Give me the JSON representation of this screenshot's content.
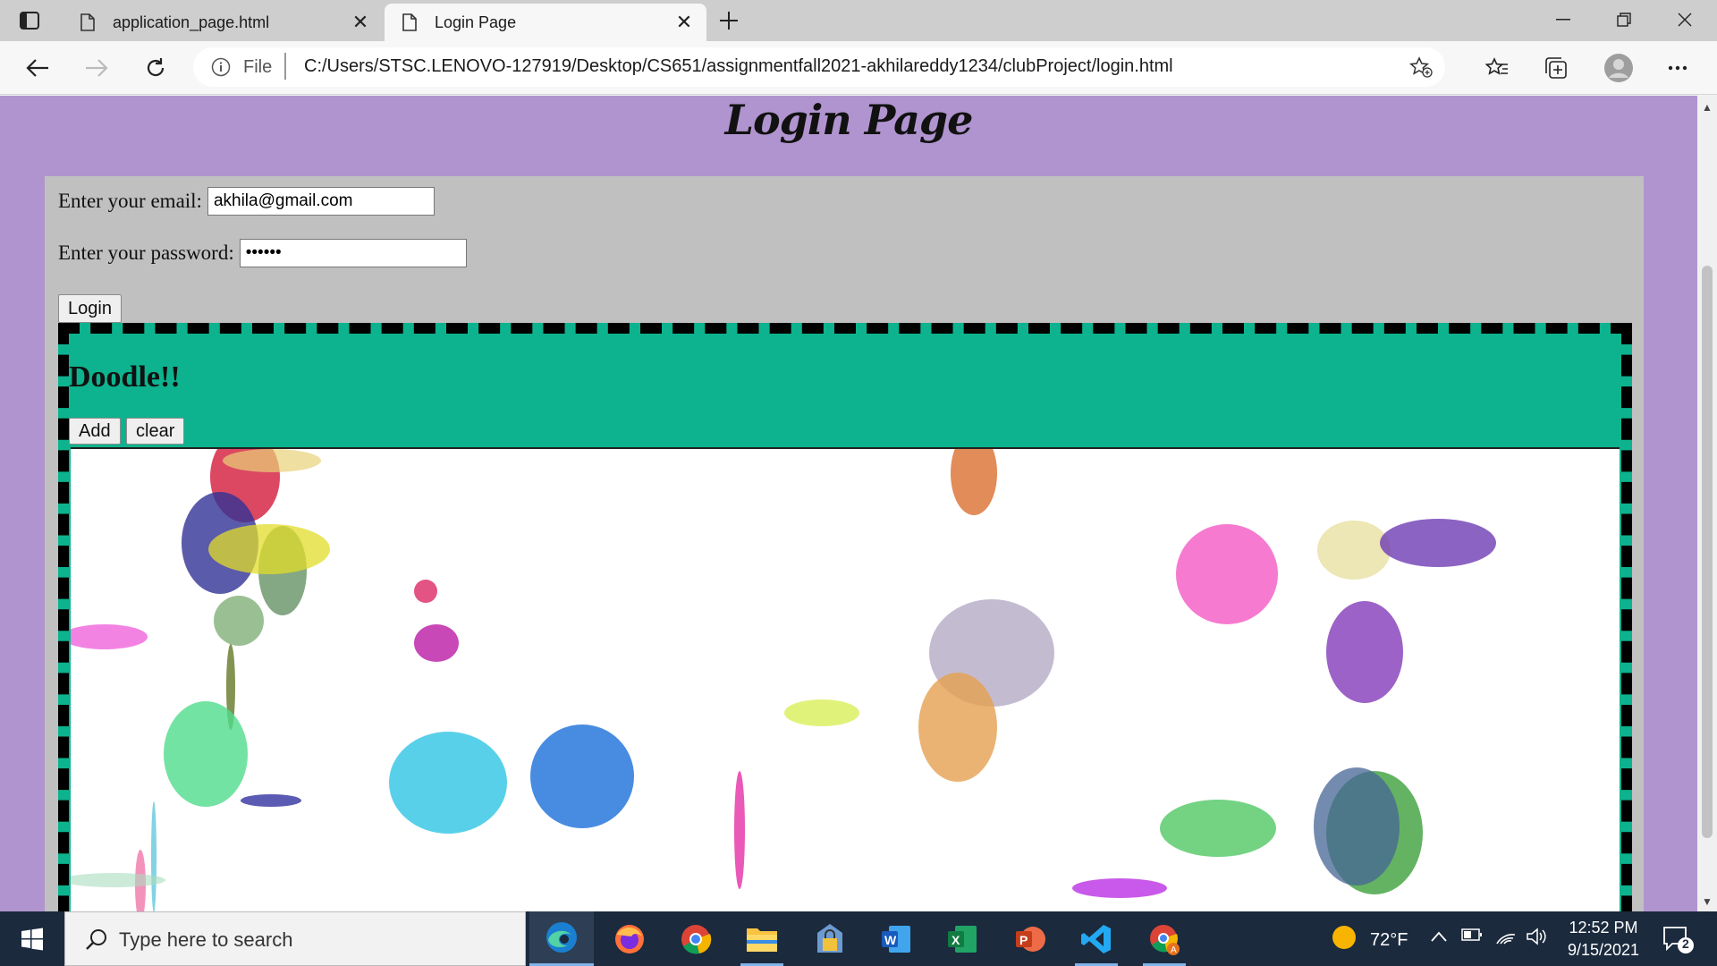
{
  "browser": {
    "tabs": [
      {
        "title": "application_page.html",
        "active": false
      },
      {
        "title": "Login Page",
        "active": true
      }
    ],
    "address": {
      "scheme": "File",
      "url": "C:/Users/STSC.LENOVO-127919/Desktop/CS651/assignmentfall2021-akhilareddy1234/clubProject/login.html"
    }
  },
  "page": {
    "heading": "Login Page",
    "email_label": "Enter your email:",
    "email_value": "akhila@gmail.com",
    "password_label": "Enter your password:",
    "password_value": "••••••",
    "login_button": "Login",
    "doodle": {
      "title": "Doodle!!",
      "add_button": "Add",
      "clear_button": "clear"
    }
  },
  "colors": {
    "page_background": "#b094cf",
    "form_background": "#c0c0c0",
    "doodle_background": "#0db38e"
  },
  "taskbar": {
    "search_placeholder": "Type here to search",
    "apps": [
      "edge-icon",
      "firefox-icon",
      "chrome-icon",
      "file-explorer-icon",
      "vpn-lock-icon",
      "word-icon",
      "excel-icon",
      "powerpoint-icon",
      "vscode-icon",
      "chrome-profile-icon"
    ],
    "temperature": "72°F",
    "time": "12:52 PM",
    "date": "9/15/2021",
    "notification_count": "2"
  }
}
